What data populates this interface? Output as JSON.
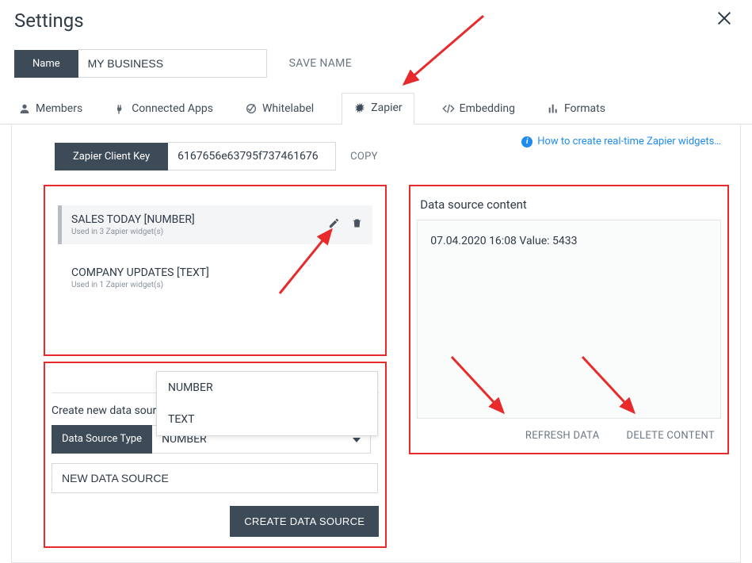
{
  "header": {
    "title": "Settings"
  },
  "name_row": {
    "label": "Name",
    "value": "MY BUSINESS",
    "save": "SAVE NAME"
  },
  "tabs": [
    {
      "label": "Members"
    },
    {
      "label": "Connected Apps"
    },
    {
      "label": "Whitelabel"
    },
    {
      "label": "Zapier"
    },
    {
      "label": "Embedding"
    },
    {
      "label": "Formats"
    }
  ],
  "help": {
    "text": "How to create real-time Zapier widgets…"
  },
  "client_key": {
    "label": "Zapier Client Key",
    "value": "6167656e63795f737461676",
    "copy": "COPY"
  },
  "sources": [
    {
      "title": "SALES TODAY [NUMBER]",
      "sub": "Used in 3 Zapier widget(s)"
    },
    {
      "title": "COMPANY UPDATES [TEXT]",
      "sub": "Used in 1 Zapier widget(s)"
    }
  ],
  "create": {
    "heading": "Create new data source",
    "type_label": "Data Source Type",
    "type_value": "NUMBER",
    "options": [
      "NUMBER",
      "TEXT"
    ],
    "name_value": "NEW DATA SOURCE",
    "button": "CREATE DATA SOURCE"
  },
  "right": {
    "title": "Data source content",
    "content": "07.04.2020 16:08 Value: 5433",
    "refresh": "REFRESH DATA",
    "delete": "DELETE CONTENT"
  }
}
